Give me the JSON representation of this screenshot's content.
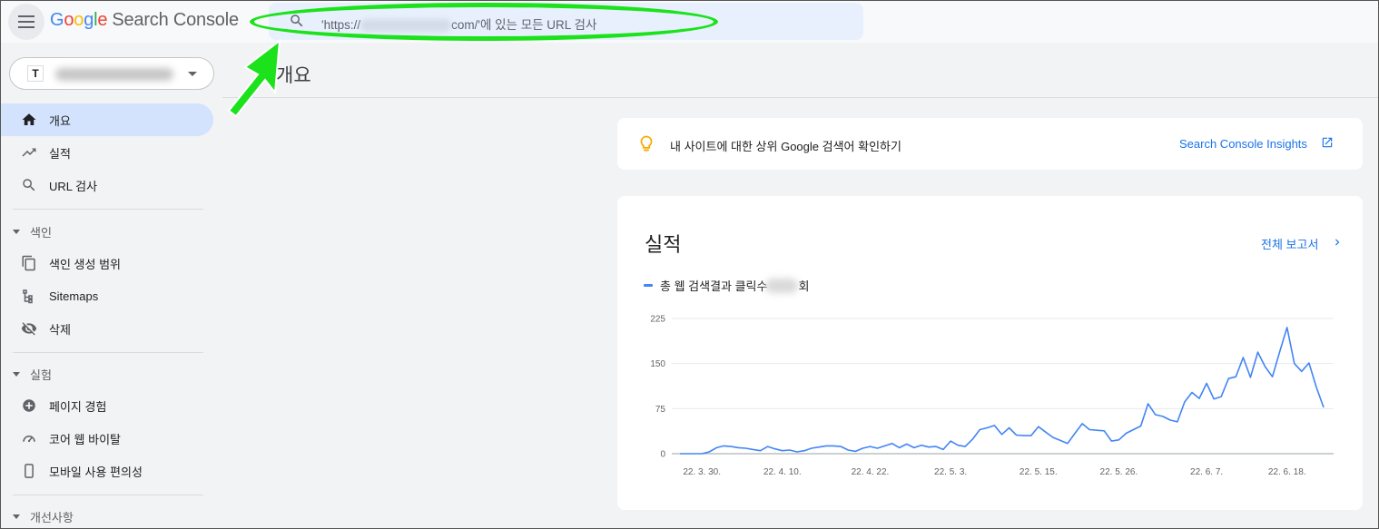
{
  "header": {
    "logo_letters": [
      "G",
      "o",
      "o",
      "g",
      "l",
      "e"
    ],
    "product": "Search Console",
    "search_placeholder_start": "'https://",
    "search_placeholder_end": "com/'에 있는 모든 URL 검사"
  },
  "property": {
    "icon_letter": "T"
  },
  "page_title": "개요",
  "sidebar": {
    "items_top": [
      {
        "label": "개요",
        "icon": "home-icon",
        "active": true
      },
      {
        "label": "실적",
        "icon": "trending-up-icon"
      },
      {
        "label": "URL 검사",
        "icon": "search-icon"
      }
    ],
    "section_index": "색인",
    "items_index": [
      {
        "label": "색인 생성 범위",
        "icon": "copy-icon"
      },
      {
        "label": "Sitemaps",
        "icon": "sitemap-icon"
      },
      {
        "label": "삭제",
        "icon": "eye-off-icon"
      }
    ],
    "section_experience": "실험",
    "items_experience": [
      {
        "label": "페이지 경험",
        "icon": "plus-circle-icon"
      },
      {
        "label": "코어 웹 바이탈",
        "icon": "gauge-icon"
      },
      {
        "label": "모바일 사용 편의성",
        "icon": "phone-icon"
      }
    ],
    "section_enhancements": "개선사항"
  },
  "insight": {
    "text": "내 사이트에 대한 상위 Google 검색어 확인하기",
    "link": "Search Console Insights"
  },
  "performance": {
    "title": "실적",
    "full_report": "전체 보고서",
    "legend_start": "총 웹 검색결과 클릭수",
    "legend_end": "회"
  },
  "colors": {
    "accent": "#1a73e8",
    "line": "#4285f4",
    "highlight": "#1be21b"
  },
  "chart_data": {
    "type": "line",
    "x_ticks": [
      "22. 3. 30.",
      "22. 4. 10.",
      "22. 4. 22.",
      "22. 5. 3.",
      "22. 5. 15.",
      "22. 5. 26.",
      "22. 6. 7.",
      "22. 6. 18."
    ],
    "y_ticks": [
      0,
      75,
      150,
      225
    ],
    "ylim": [
      0,
      225
    ],
    "grid": true,
    "series": [
      {
        "name": "총 웹 검색결과 클릭수",
        "values": [
          0,
          0,
          0,
          0,
          3,
          10,
          13,
          12,
          10,
          9,
          7,
          5,
          12,
          8,
          5,
          6,
          3,
          5,
          9,
          11,
          13,
          13,
          12,
          6,
          4,
          9,
          12,
          9,
          13,
          17,
          10,
          16,
          10,
          14,
          11,
          12,
          7,
          21,
          14,
          12,
          24,
          40,
          43,
          47,
          32,
          43,
          31,
          30,
          30,
          45,
          36,
          27,
          22,
          17,
          34,
          50,
          40,
          39,
          38,
          21,
          23,
          34,
          40,
          46,
          83,
          65,
          62,
          56,
          53,
          86,
          102,
          92,
          117,
          91,
          95,
          125,
          128,
          160,
          127,
          169,
          145,
          128,
          170,
          210,
          150,
          137,
          151,
          111,
          77
        ],
        "start_date": "2022-03-27"
      }
    ]
  }
}
